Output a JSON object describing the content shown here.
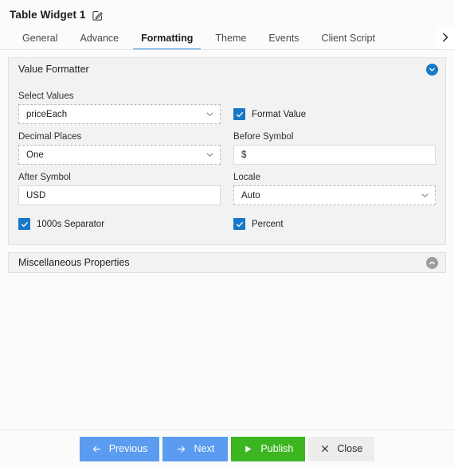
{
  "header": {
    "title": "Table Widget 1",
    "edit_icon": "edit-pencil-icon"
  },
  "tabs": {
    "items": [
      {
        "label": "General",
        "active": false
      },
      {
        "label": "Advance",
        "active": false
      },
      {
        "label": "Formatting",
        "active": true
      },
      {
        "label": "Theme",
        "active": false
      },
      {
        "label": "Events",
        "active": false
      },
      {
        "label": "Client Script",
        "active": false
      }
    ],
    "scroll_right_icon": "chevron-right-icon",
    "active_indicator_color": "#2b8ce0"
  },
  "value_formatter": {
    "title": "Value Formatter",
    "collapse_icon": "chevron-down-circle-icon",
    "collapse_icon_color": "#1878c8",
    "select_values": {
      "label": "Select Values",
      "value": "priceEach",
      "chevron_icon": "chevron-down-icon"
    },
    "format_value": {
      "label": "Format Value",
      "checked": true,
      "check_icon": "check-icon"
    },
    "decimal_places": {
      "label": "Decimal Places",
      "value": "One",
      "chevron_icon": "chevron-down-icon"
    },
    "before_symbol": {
      "label": "Before Symbol",
      "value": "$",
      "placeholder": ""
    },
    "after_symbol": {
      "label": "After Symbol",
      "value": "USD",
      "placeholder": ""
    },
    "locale": {
      "label": "Locale",
      "value": "Auto",
      "chevron_icon": "chevron-down-icon"
    },
    "thousands_separator": {
      "label": "1000s Separator",
      "checked": true,
      "check_icon": "check-icon"
    },
    "percent": {
      "label": "Percent",
      "checked": true,
      "check_icon": "check-icon"
    },
    "checkbox_color": "#1878c8"
  },
  "misc_properties": {
    "title": "Miscellaneous Properties",
    "expand_icon": "chevron-up-circle-icon",
    "expand_icon_color": "#9d9d9d"
  },
  "footer": {
    "buttons": [
      {
        "label": "Previous",
        "icon": "arrow-left-icon",
        "color": "#5b9bf0"
      },
      {
        "label": "Next",
        "icon": "arrow-right-icon",
        "color": "#5b9bf0"
      },
      {
        "label": "Publish",
        "icon": "play-icon",
        "color": "#3cb521"
      },
      {
        "label": "Close",
        "icon": "close-x-icon",
        "color": "#ededed"
      }
    ]
  }
}
